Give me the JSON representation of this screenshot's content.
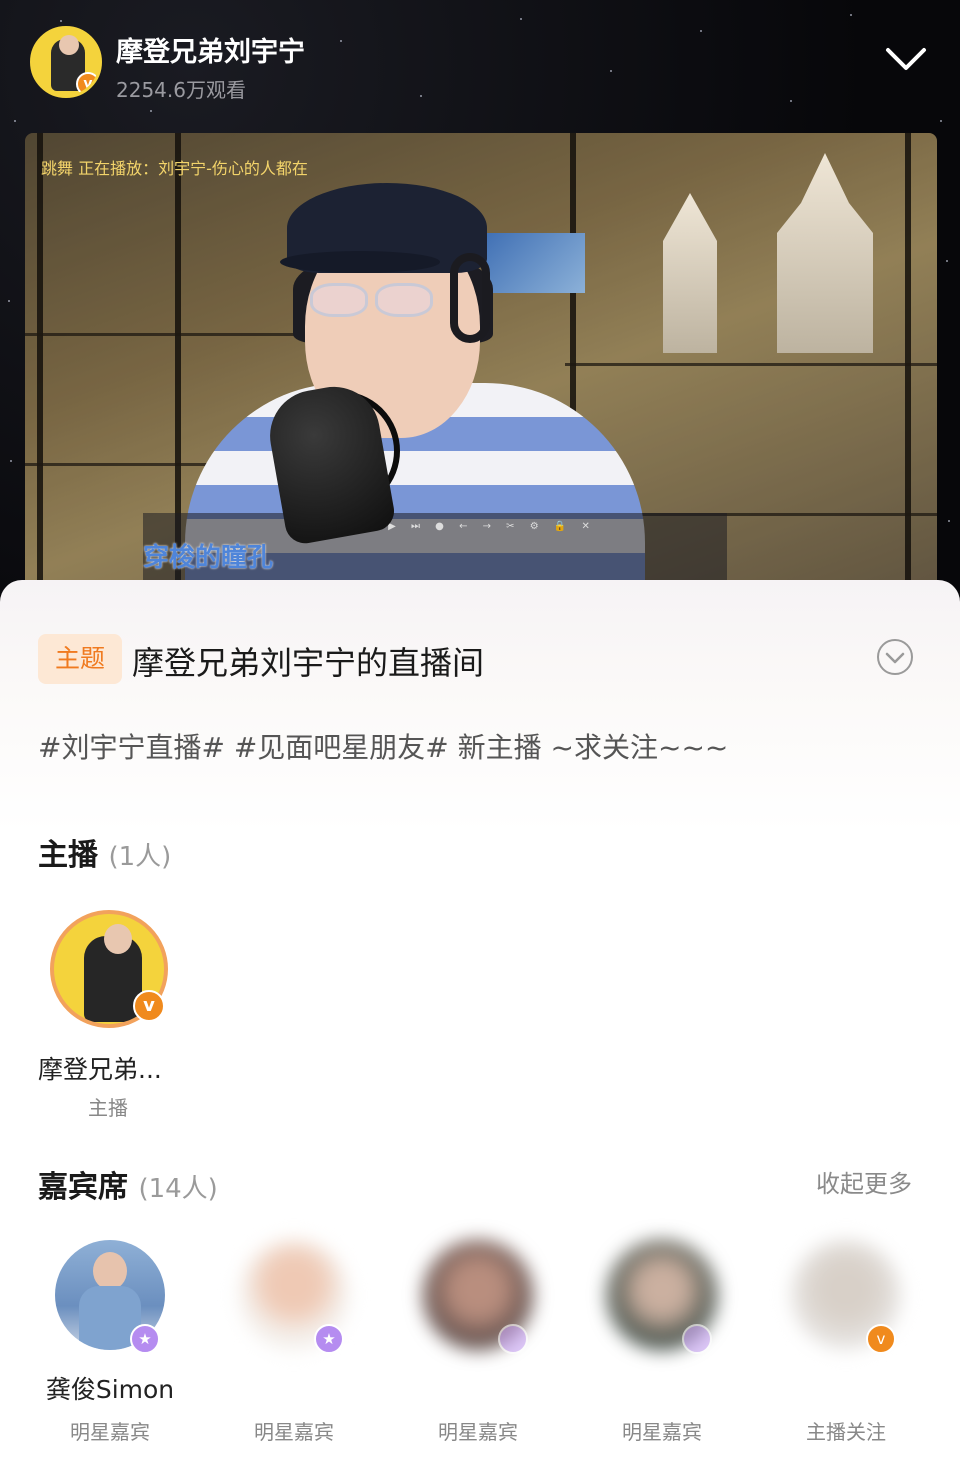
{
  "header": {
    "host_name": "摩登兄弟刘宇宁",
    "viewers": "2254.6万观看",
    "verified_badge": "v"
  },
  "video": {
    "now_playing": "跳舞 正在播放：刘宇宁-伤心的人都在",
    "lyric": "穿梭的瞳孔",
    "player_controls": "◎ ▯g ⏮ ▶ ⏭ ● ← → ✂ ⚙ 🔒 ✕"
  },
  "sheet": {
    "topic_tag": "主题",
    "room_title": "摩登兄弟刘宇宁的直播间",
    "hashtags": "#刘宇宁直播#  #见面吧星朋友#   新主播 ~求关注~~~",
    "host_section": {
      "title": "主播",
      "count": "(1人)"
    },
    "host": {
      "name": "摩登兄弟...",
      "role": "主播"
    },
    "guest_section": {
      "title": "嘉宾席",
      "count": "(14人)",
      "collapse_label": "收起更多"
    },
    "guests": [
      {
        "name": "龚俊Simon",
        "role": "明星嘉宾",
        "badge": "★"
      },
      {
        "name": "",
        "role": "明星嘉宾",
        "badge": "★"
      },
      {
        "name": "",
        "role": "明星嘉宾",
        "badge": ""
      },
      {
        "name": "",
        "role": "明星嘉宾",
        "badge": ""
      },
      {
        "name": "",
        "role": "主播关注",
        "badge": "v"
      }
    ]
  },
  "colors": {
    "accent_orange": "#f07a1f",
    "topic_tag_bg": "#fde8d5",
    "star_badge_purple": "#b58cf0",
    "verified_orange": "#f08a1d"
  },
  "icons": {
    "collapse": "chevron-down-icon",
    "expand": "circle-chevron-down-icon",
    "verified": "verified-badge-icon",
    "star_guest": "star-badge-icon"
  }
}
